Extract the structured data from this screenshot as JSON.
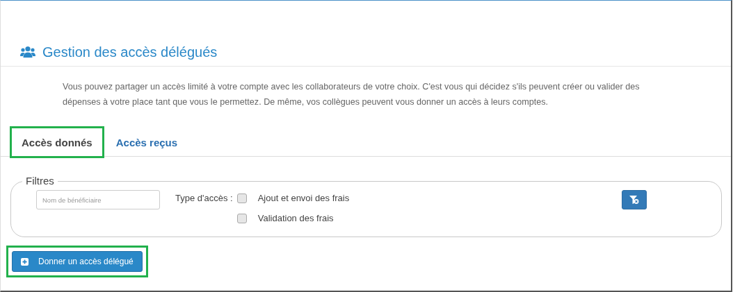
{
  "page": {
    "title": "Gestion des accès délégués",
    "description": "Vous pouvez partager un accès limité à votre compte avec les collaborateurs de votre choix. C'est vous qui décidez s'ils peuvent créer ou valider des dépenses à votre place tant que vous le permettez. De même, vos collègues peuvent vous donner un accès à leurs comptes."
  },
  "tabs": [
    {
      "label": "Accès donnés",
      "selected": true,
      "highlighted": true
    },
    {
      "label": "Accès reçus",
      "selected": false,
      "highlighted": false
    }
  ],
  "filters": {
    "legend": "Filtres",
    "name_field": {
      "placeholder": "Nom de bénéficiaire"
    },
    "access_type_label": "Type d'accès :",
    "options": [
      {
        "label": "Ajout et envoi des frais",
        "checked": false
      },
      {
        "label": "Validation des frais",
        "checked": false
      }
    ]
  },
  "add_button": {
    "label": "Donner un accès délégué",
    "highlighted": true
  }
}
